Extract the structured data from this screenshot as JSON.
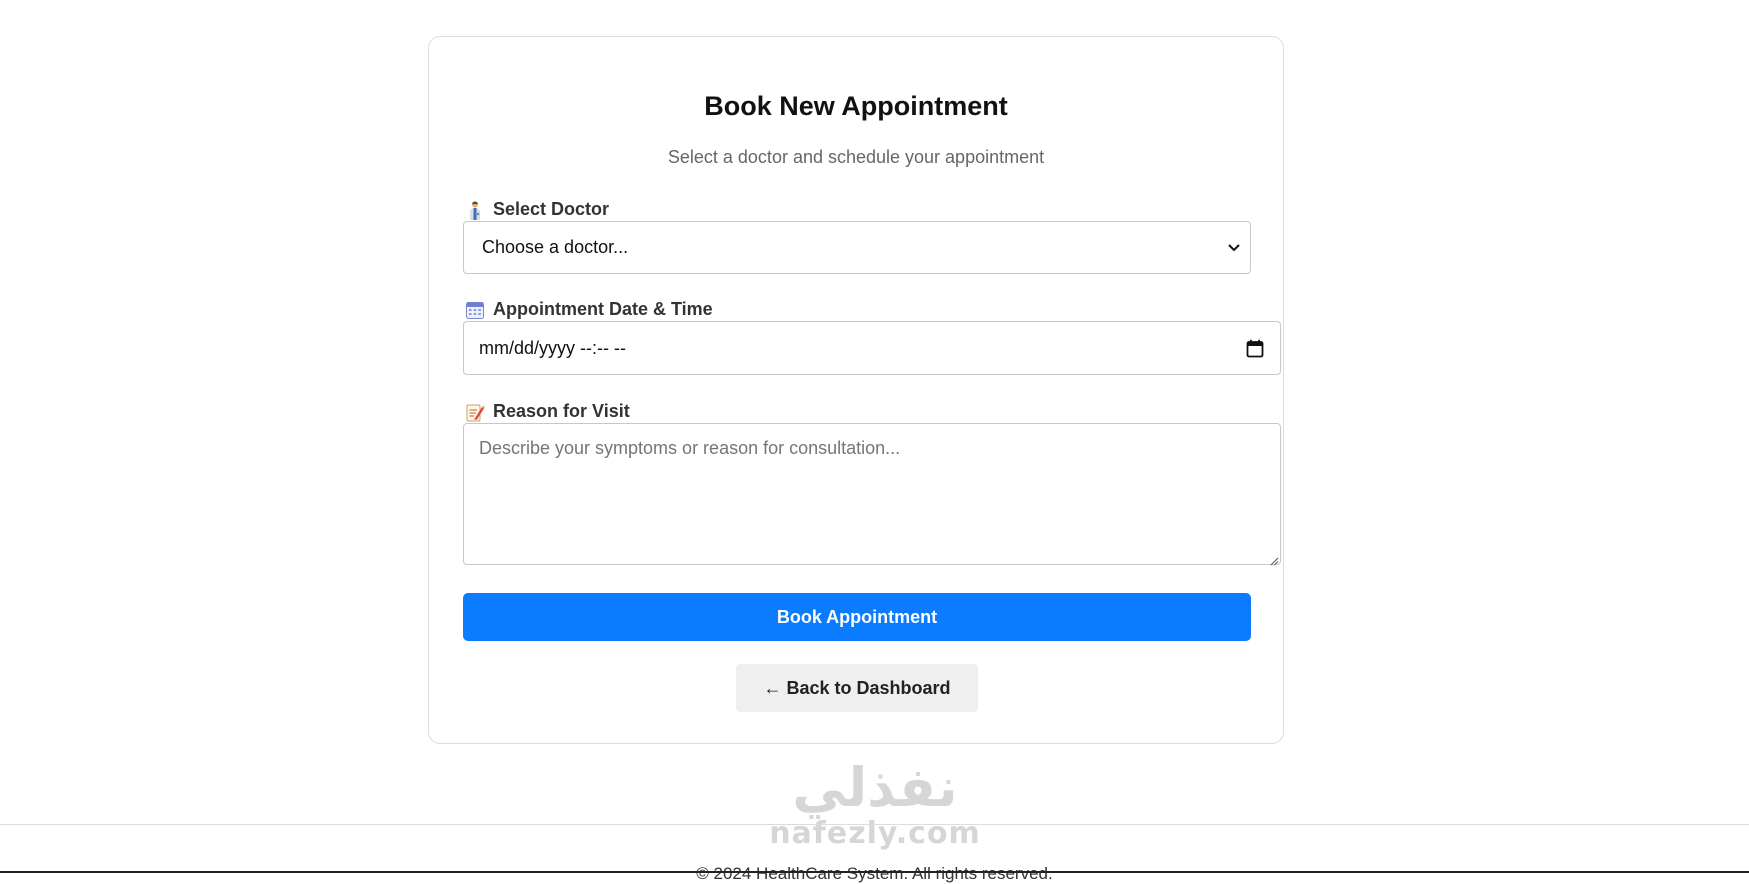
{
  "form": {
    "title": "Book New Appointment",
    "subtitle": "Select a doctor and schedule your appointment",
    "doctor_label": "Select Doctor",
    "doctor_icon": "doctor-icon",
    "doctor_select_value": "Choose a doctor...",
    "datetime_label": "Appointment Date & Time",
    "datetime_icon": "calendar-icon",
    "datetime_value": "mm/dd/yyyy --:-- --",
    "reason_label": "Reason for Visit",
    "reason_icon": "memo-icon",
    "reason_placeholder": "Describe your symptoms or reason for consultation...",
    "submit_label": "Book Appointment",
    "back_label": "← Back to Dashboard"
  },
  "watermark": {
    "arabic": "نفذلي",
    "latin": "nafezly.com"
  },
  "footer": {
    "text": "© 2024 HealthCare System. All rights reserved."
  },
  "colors": {
    "primary": "#0b7bff",
    "card_border": "#dedede",
    "secondary_button": "#efefef",
    "subtitle": "#666666"
  }
}
